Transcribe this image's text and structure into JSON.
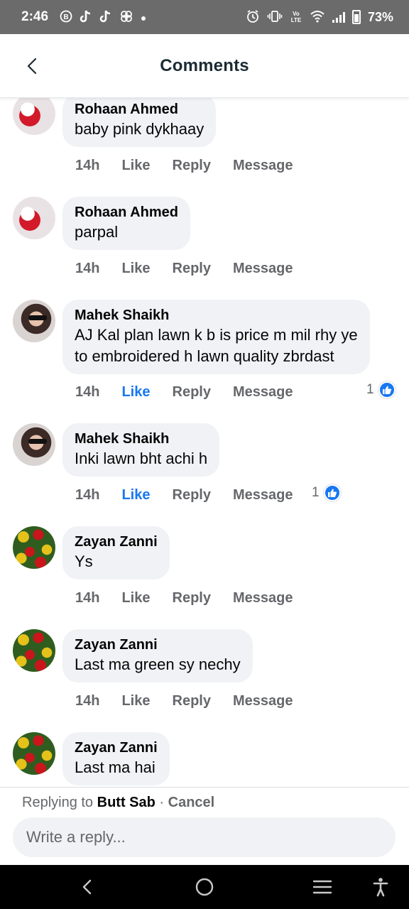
{
  "status_bar": {
    "time": "2:46",
    "left_icons": [
      "b-circle-icon",
      "tiktok-icon",
      "tiktok-icon",
      "pinwheel-icon",
      "dot-icon"
    ],
    "right_icons": [
      "alarm-icon",
      "vibrate-icon",
      "volte-icon",
      "wifi-icon",
      "signal-icon",
      "battery-icon"
    ],
    "volte_label": "Vo0\nLTE",
    "battery": "73%"
  },
  "header": {
    "title": "Comments"
  },
  "colors": {
    "accent": "#1877f2",
    "bubble": "#f0f2f5",
    "secondary_text": "#65676b",
    "status_bar": "#6b6b6b",
    "nav_bar": "#000000"
  },
  "comments": [
    {
      "name": "Rohaan Ahmed",
      "text": "baby pink dykhaay",
      "time": "14h",
      "like": "Like",
      "reply": "Reply",
      "message": "Message",
      "liked": false,
      "reactions": ""
    },
    {
      "name": "Rohaan Ahmed",
      "text": "parpal",
      "time": "14h",
      "like": "Like",
      "reply": "Reply",
      "message": "Message",
      "liked": false,
      "reactions": ""
    },
    {
      "name": "Mahek Shaikh",
      "text_lines": [
        "AJ Kal plan lawn k b is price m mil rhy ye",
        "to embroidered h lawn quality zbrdast"
      ],
      "time": "14h",
      "like": "Like",
      "reply": "Reply",
      "message": "Message",
      "liked": true,
      "reactions": "1"
    },
    {
      "name": "Mahek Shaikh",
      "text": "Inki lawn bht achi h",
      "time": "14h",
      "like": "Like",
      "reply": "Reply",
      "message": "Message",
      "liked": true,
      "reactions": "1"
    },
    {
      "name": "Zayan Zanni",
      "text": "Ys",
      "time": "14h",
      "like": "Like",
      "reply": "Reply",
      "message": "Message",
      "liked": false,
      "reactions": ""
    },
    {
      "name": "Zayan Zanni",
      "text": "Last ma green sy nechy",
      "time": "14h",
      "like": "Like",
      "reply": "Reply",
      "message": "Message",
      "liked": false,
      "reactions": ""
    },
    {
      "name": "Zayan Zanni",
      "text": "Last ma hai"
    }
  ],
  "reply_bar": {
    "replying_prefix": "Replying to",
    "replying_name": "Butt Sab",
    "separator": "·",
    "cancel": "Cancel",
    "placeholder": "Write a reply..."
  },
  "nav_bar": {
    "icons": [
      "back-icon",
      "home-icon",
      "recents-icon",
      "accessibility-icon"
    ]
  }
}
